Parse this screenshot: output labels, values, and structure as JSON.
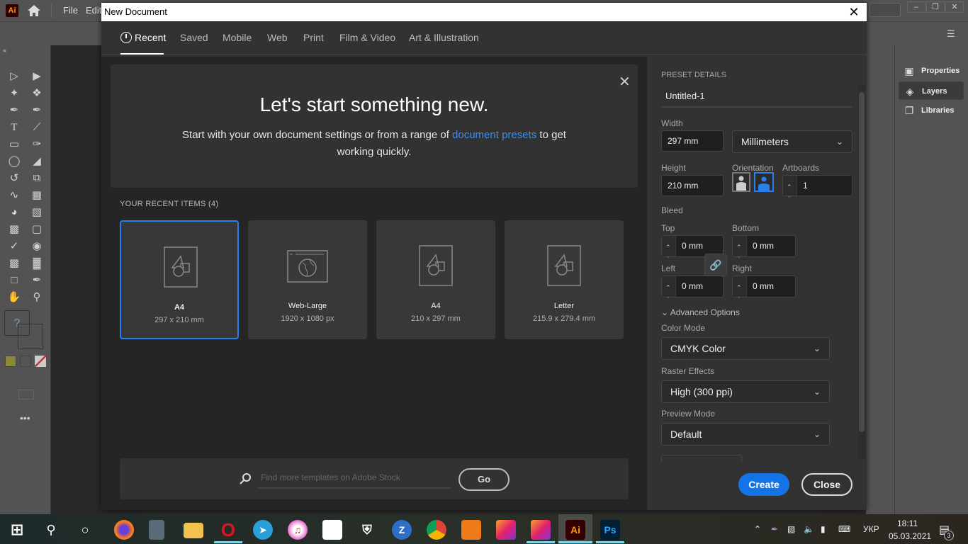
{
  "app": {
    "logo": "Ai",
    "menu": [
      "File",
      "Edit"
    ],
    "right_panel": [
      {
        "label": "Properties",
        "icon": "properties-icon",
        "active": false
      },
      {
        "label": "Layers",
        "icon": "layers-icon",
        "active": true
      },
      {
        "label": "Libraries",
        "icon": "libraries-icon",
        "active": false
      }
    ]
  },
  "dialog": {
    "title": "New Document",
    "tabs": [
      {
        "label": "Recent",
        "active": true
      },
      {
        "label": "Saved"
      },
      {
        "label": "Mobile"
      },
      {
        "label": "Web"
      },
      {
        "label": "Print"
      },
      {
        "label": "Film & Video"
      },
      {
        "label": "Art & Illustration"
      }
    ],
    "hero": {
      "title": "Let's start something new.",
      "text_before": "Start with your own document settings or from a range of ",
      "link": "document presets",
      "text_after": " to get working quickly."
    },
    "recent": {
      "title": "YOUR RECENT ITEMS",
      "count": "(4)",
      "items": [
        {
          "name": "A4",
          "dims": "297 x 210 mm",
          "icon": "document-icon",
          "selected": true
        },
        {
          "name": "Web-Large",
          "dims": "1920 x 1080 px",
          "icon": "web-icon",
          "selected": false
        },
        {
          "name": "A4",
          "dims": "210 x 297 mm",
          "icon": "document-icon",
          "selected": false
        },
        {
          "name": "Letter",
          "dims": "215.9 x 279.4 mm",
          "icon": "document-icon",
          "selected": false
        }
      ]
    },
    "stock": {
      "placeholder": "Find more templates on Adobe Stock",
      "value": "",
      "go_label": "Go"
    },
    "preset": {
      "heading": "PRESET DETAILS",
      "name": "Untitled-1",
      "width_label": "Width",
      "width": "297 mm",
      "units": "Millimeters",
      "height_label": "Height",
      "height": "210 mm",
      "orientation_label": "Orientation",
      "orientation": "landscape",
      "artboards_label": "Artboards",
      "artboards": "1",
      "bleed_label": "Bleed",
      "bleed": {
        "top_label": "Top",
        "top": "0 mm",
        "bottom_label": "Bottom",
        "bottom": "0 mm",
        "left_label": "Left",
        "left": "0 mm",
        "right_label": "Right",
        "right": "0 mm"
      },
      "advanced_label": "Advanced Options",
      "color_mode_label": "Color Mode",
      "color_mode": "CMYK Color",
      "raster_label": "Raster Effects",
      "raster": "High (300 ppi)",
      "preview_label": "Preview Mode",
      "preview": "Default"
    },
    "create_label": "Create",
    "close_label": "Close"
  },
  "taskbar": {
    "apps": [
      "start",
      "search",
      "cortana",
      "firefox",
      "calculator",
      "file-explorer",
      "opera",
      "telegram",
      "itunes",
      "store",
      "security",
      "zona",
      "chrome",
      "camera",
      "creative-cloud",
      "creative-cloud",
      "illustrator",
      "photoshop"
    ],
    "lang": "УКР",
    "time": "18:11",
    "date": "05.03.2021",
    "notifications": "3"
  },
  "colors": {
    "accent": "#1473e6",
    "link": "#3d8ee9",
    "selected_border": "#2680eb"
  }
}
